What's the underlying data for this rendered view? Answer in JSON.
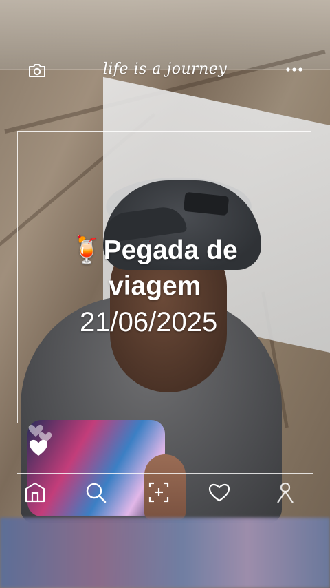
{
  "header": {
    "title": "life is a journey",
    "camera_icon": "camera-icon",
    "more_icon": "more-dots-icon"
  },
  "caption": {
    "emoji": "🍹",
    "line1": "Pegada de",
    "line2": "viagem",
    "date": "21/06/2025"
  },
  "nav": {
    "items": [
      "home-icon",
      "search-icon",
      "add-post-icon",
      "heart-icon",
      "profile-icon"
    ]
  },
  "colors": {
    "overlay_white": "#ffffff"
  }
}
